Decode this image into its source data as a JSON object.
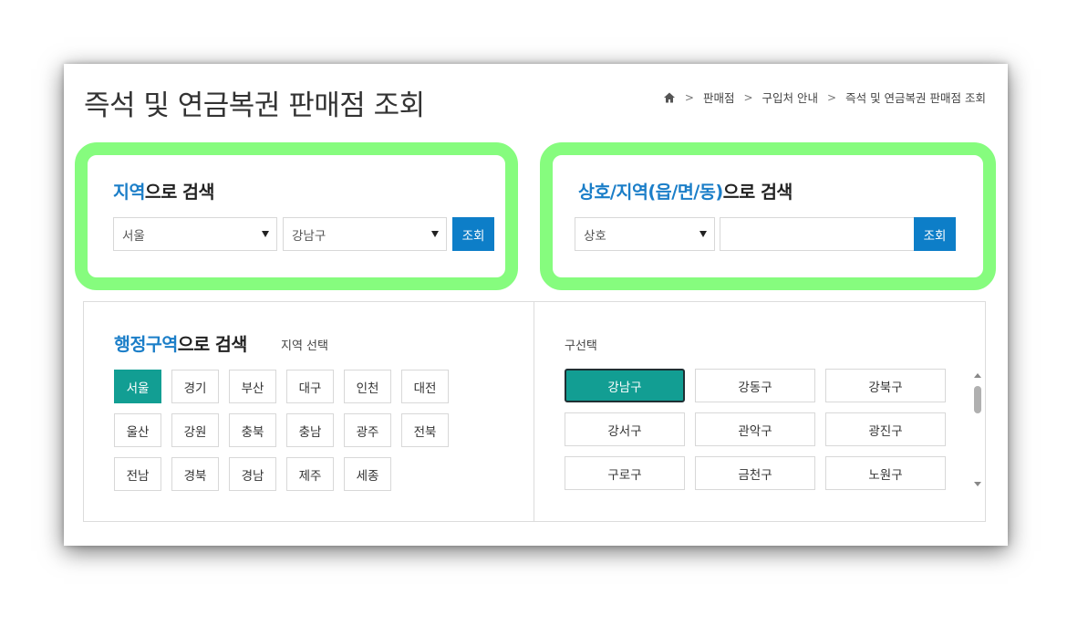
{
  "page_title": "즉석 및 연금복권 판매점 조회",
  "breadcrumb": {
    "home_icon": "home-icon",
    "items": [
      "판매점",
      "구입처 안내",
      "즉석 및 연금복권 판매점 조회"
    ]
  },
  "region_search": {
    "title_highlight": "지역",
    "title_rest": "으로 검색",
    "province_selected": "서울",
    "district_selected": "강남구",
    "button_label": "조회"
  },
  "name_search": {
    "title_highlight": "상호/지역(읍/면/동)",
    "title_rest": "으로 검색",
    "type_selected": "상호",
    "input_value": "",
    "button_label": "조회"
  },
  "admin_search": {
    "title_highlight": "행정구역",
    "title_rest": "으로 검색",
    "subtitle": "지역 선택",
    "regions": [
      "서울",
      "경기",
      "부산",
      "대구",
      "인천",
      "대전",
      "울산",
      "강원",
      "충북",
      "충남",
      "광주",
      "전북",
      "전남",
      "경북",
      "경남",
      "제주",
      "세종"
    ],
    "active_region": "서울",
    "district_label": "구선택",
    "districts": [
      "강남구",
      "강동구",
      "강북구",
      "강서구",
      "관악구",
      "광진구",
      "구로구",
      "금천구",
      "노원구"
    ],
    "active_district": "강남구"
  },
  "colors": {
    "accent_blue": "#0d7ec8",
    "title_blue": "#1b7ec8",
    "teal_active": "#129e93",
    "highlight_green": "#86fc7e"
  }
}
